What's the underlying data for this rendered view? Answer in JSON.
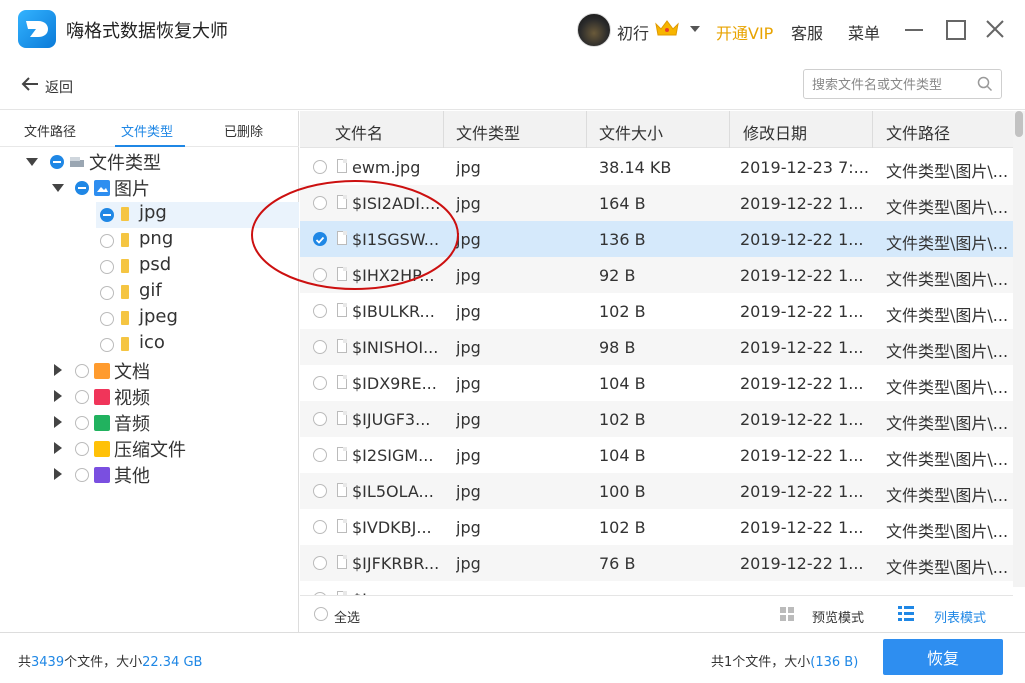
{
  "app": {
    "title": "嗨格式数据恢复大师"
  },
  "header": {
    "username": "初行",
    "vip_label": "开通VIP",
    "service_label": "客服",
    "menu_label": "菜单"
  },
  "nav": {
    "back_label": "返回",
    "search_placeholder": "搜索文件名或文件类型"
  },
  "left_tabs": [
    "文件路径",
    "文件类型",
    "已删除"
  ],
  "tree": {
    "root": "文件类型",
    "images": "图片",
    "image_types": [
      "jpg",
      "png",
      "psd",
      "gif",
      "jpeg",
      "ico"
    ],
    "categories": [
      {
        "label": "文档",
        "color": "#ff9b2e"
      },
      {
        "label": "视频",
        "color": "#f0355a"
      },
      {
        "label": "音频",
        "color": "#21b25f"
      },
      {
        "label": "压缩文件",
        "color": "#ffc107"
      },
      {
        "label": "其他",
        "color": "#7a4fe0"
      }
    ]
  },
  "table": {
    "columns": [
      "文件名",
      "文件类型",
      "文件大小",
      "修改日期",
      "文件路径"
    ],
    "rows": [
      {
        "name": "ewm.jpg",
        "type": "jpg",
        "size": "38.14 KB",
        "date": "2019-12-23 7:...",
        "path": "文件类型\\图片\\..."
      },
      {
        "name": "$ISI2ADI....",
        "type": "jpg",
        "size": "164 B",
        "date": "2019-12-22 1...",
        "path": "文件类型\\图片\\..."
      },
      {
        "name": "$I1SGSW...",
        "type": "jpg",
        "size": "136 B",
        "date": "2019-12-22 1...",
        "path": "文件类型\\图片\\..."
      },
      {
        "name": "$IHX2HP...",
        "type": "jpg",
        "size": "92 B",
        "date": "2019-12-22 1...",
        "path": "文件类型\\图片\\..."
      },
      {
        "name": "$IBULKR...",
        "type": "jpg",
        "size": "102 B",
        "date": "2019-12-22 1...",
        "path": "文件类型\\图片\\..."
      },
      {
        "name": "$INISHOI...",
        "type": "jpg",
        "size": "98 B",
        "date": "2019-12-22 1...",
        "path": "文件类型\\图片\\..."
      },
      {
        "name": "$IDX9RE...",
        "type": "jpg",
        "size": "104 B",
        "date": "2019-12-22 1...",
        "path": "文件类型\\图片\\..."
      },
      {
        "name": "$IJUGF3...",
        "type": "jpg",
        "size": "102 B",
        "date": "2019-12-22 1...",
        "path": "文件类型\\图片\\..."
      },
      {
        "name": "$I2SIGM...",
        "type": "jpg",
        "size": "104 B",
        "date": "2019-12-22 1...",
        "path": "文件类型\\图片\\..."
      },
      {
        "name": "$IL5OLA...",
        "type": "jpg",
        "size": "100 B",
        "date": "2019-12-22 1...",
        "path": "文件类型\\图片\\..."
      },
      {
        "name": "$IVDKBJ...",
        "type": "jpg",
        "size": "102 B",
        "date": "2019-12-22 1...",
        "path": "文件类型\\图片\\..."
      },
      {
        "name": "$IJFKRBR...",
        "type": "jpg",
        "size": "76 B",
        "date": "2019-12-22 1...",
        "path": "文件类型\\图片\\..."
      },
      {
        "name": "$I...",
        "type": "",
        "size": "",
        "date": "",
        "path": ""
      }
    ],
    "selected_row": 2
  },
  "footer": {
    "select_all": "全选",
    "preview_mode": "预览模式",
    "list_mode": "列表模式"
  },
  "status": {
    "total_prefix": "共",
    "total_count": "3439",
    "total_mid": "个文件，大小",
    "total_size": "22.34 GB",
    "selected_text": "共1个文件，大小",
    "selected_size": "(136 B)",
    "recover_label": "恢复"
  },
  "colors": {
    "accent": "#1f87e5",
    "vip": "#e8a300",
    "selected_row": "#d5e9fb",
    "annotation": "#cc1010"
  }
}
